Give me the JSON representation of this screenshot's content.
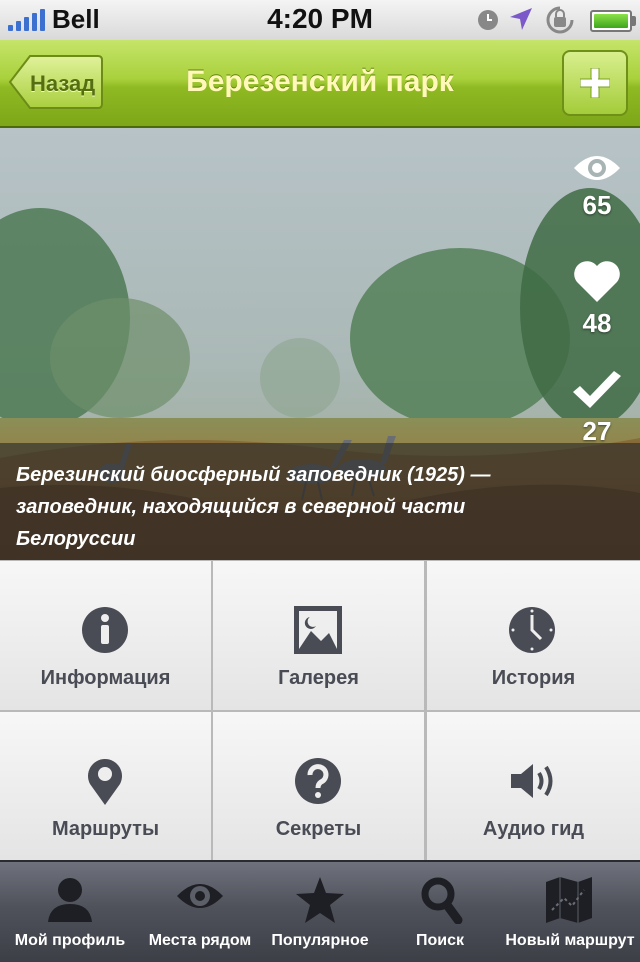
{
  "status_bar": {
    "carrier": "Bell",
    "time": "4:20 PM"
  },
  "nav": {
    "back_label": "Назад",
    "title": "Березенский парк"
  },
  "stats": {
    "views": "65",
    "likes": "48",
    "checkins": "27"
  },
  "caption": "Березинский биосферный заповедник (1925) — заповедник, находящийся в северной части Белоруссии",
  "tiles": [
    {
      "label": "Информация",
      "icon": "info-icon"
    },
    {
      "label": "Галерея",
      "icon": "gallery-icon"
    },
    {
      "label": "История",
      "icon": "clock-icon"
    },
    {
      "label": "Маршруты",
      "icon": "map-pin-icon"
    },
    {
      "label": "Секреты",
      "icon": "question-icon"
    },
    {
      "label": "Аудио гид",
      "icon": "speaker-icon"
    }
  ],
  "tabs": [
    {
      "label": "Мой профиль",
      "icon": "person-icon"
    },
    {
      "label": "Места рядом",
      "icon": "eye-icon"
    },
    {
      "label": "Популярное",
      "icon": "star-icon"
    },
    {
      "label": "Поиск",
      "icon": "search-icon"
    },
    {
      "label": "Новый маршрут",
      "icon": "map-icon"
    }
  ],
  "colors": {
    "nav_green": "#9cc42e",
    "title_yellow": "#fff8b8",
    "tile_text": "#4a4c55",
    "icon_dark": "#4a4c55"
  }
}
